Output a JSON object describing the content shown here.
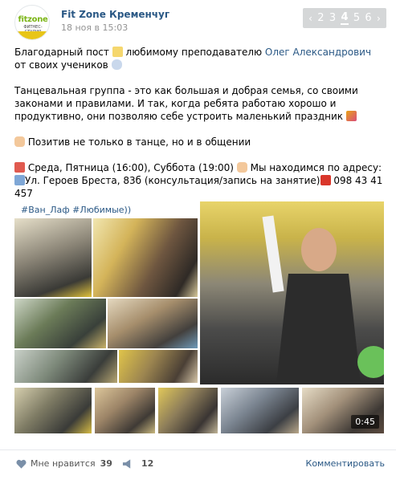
{
  "post": {
    "group_name": "Fit Zone Кременчуг",
    "date": "18 ноя в 15:03",
    "avatar": {
      "logo_text": "fitzone",
      "logo_sub": "ФИТНЕС-СТУДИЯ"
    },
    "pager": {
      "prev": "‹",
      "pages": [
        "2",
        "3",
        "4",
        "5",
        "6"
      ],
      "active": "4",
      "next": "›"
    },
    "text": {
      "line1_start": "Благодарный пост ",
      "line1_mid": " любимому преподавателю ",
      "line1_link": "Олег Александрович",
      "line1_end": " от своих учеников ",
      "para2": "Танцевальная группа - это как большая и добрая семья, со своими законами и правилами. И так, когда ребята работаю хорошо и продуктивно, они позволяю себе устроить маленький праздник ",
      "para3": " Позитив не только в танце, но и в общении",
      "para4_a": " Среда, Пятница (16:00), Суббота (19:00) ",
      "para4_b": " Мы находимся по адресу: ",
      "para4_c": "Ул. Героев Бреста, 83б (консультация/запись на занятие)",
      "para4_d": " 098 43 41 457"
    },
    "hashtags": "#Ван_Лаф #Любимые))",
    "video_duration": "0:45",
    "likes_label": "Мне нравится",
    "likes_count": "39",
    "shares_count": "12",
    "comment_label": "Комментировать"
  },
  "icons": {
    "like": "heart-icon",
    "share": "megaphone-icon",
    "pencil": "pencil-emoji",
    "speech": "speech-bubble-emoji",
    "party": "party-popper-emoji",
    "hand": "pointing-hand-emoji",
    "calendar": "calendar-emoji",
    "building": "building-emoji",
    "phone": "phone-emoji"
  },
  "colors": {
    "link": "#2a5885",
    "muted": "#939393",
    "pager_bg": "#d5d7d8"
  }
}
